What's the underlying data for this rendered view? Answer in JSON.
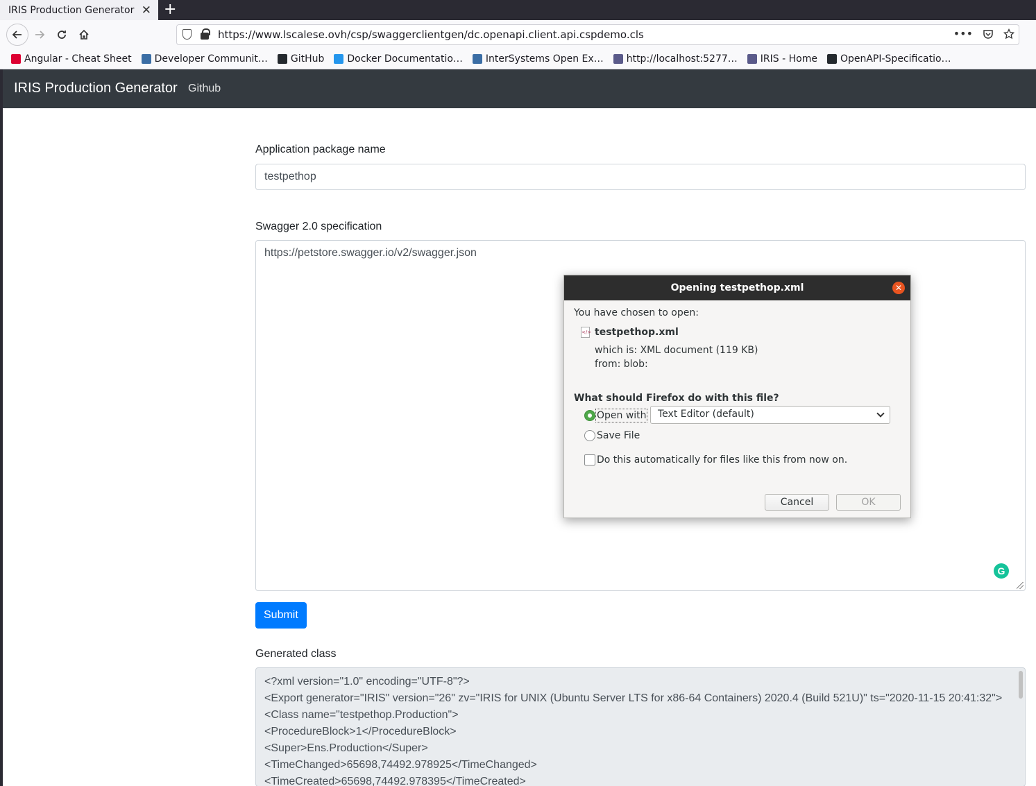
{
  "browser": {
    "tab_title": "IRIS Production Generator",
    "tab_close": "✕",
    "new_tab": "+",
    "url": "https://www.lscalese.ovh/csp/swaggerclientgen/dc.openapi.client.api.cspdemo.cls",
    "bookmarks": [
      {
        "label": "Angular - Cheat Sheet",
        "icon": "angular-icon",
        "color": "#dd0031"
      },
      {
        "label": "Developer Communit…",
        "icon": "intersystems-icon",
        "color": "#3b6ea5"
      },
      {
        "label": "GitHub",
        "icon": "github-icon",
        "color": "#24292e"
      },
      {
        "label": "Docker Documentatio…",
        "icon": "docker-icon",
        "color": "#2496ed"
      },
      {
        "label": "InterSystems Open Ex…",
        "icon": "intersystems-icon",
        "color": "#3b6ea5"
      },
      {
        "label": "http://localhost:5277…",
        "icon": "iris-icon",
        "color": "#5a5a8a"
      },
      {
        "label": "IRIS - Home",
        "icon": "iris-icon",
        "color": "#5a5a8a"
      },
      {
        "label": "OpenAPI-Specificatio…",
        "icon": "github-icon",
        "color": "#24292e"
      }
    ]
  },
  "app": {
    "brand": "IRIS Production Generator",
    "nav_link": "Github"
  },
  "form": {
    "package_label": "Application package name",
    "package_value": "testpethop",
    "spec_label": "Swagger 2.0 specification",
    "spec_value": "https://petstore.swagger.io/v2/swagger.json",
    "submit_label": "Submit",
    "generated_label": "Generated class",
    "generated_lines": [
      "<?xml version=\"1.0\" encoding=\"UTF-8\"?>",
      "<Export generator=\"IRIS\" version=\"26\" zv=\"IRIS for UNIX (Ubuntu Server LTS for x86-64 Containers) 2020.4 (Build 521U)\" ts=\"2020-11-15 20:41:32\">",
      "<Class name=\"testpethop.Production\">",
      "<ProcedureBlock>1</ProcedureBlock>",
      "<Super>Ens.Production</Super>",
      "<TimeChanged>65698,74492.978925</TimeChanged>",
      "<TimeCreated>65698,74492.978395</TimeCreated>"
    ]
  },
  "dialog": {
    "title": "Opening testpethop.xml",
    "close": "✕",
    "chosen": "You have chosen to open:",
    "filename": "testpethop.xml",
    "which_is": "which is: XML document (119 KB)",
    "from": "from: blob:",
    "question": "What should Firefox do with this file?",
    "open_with": "Open with",
    "open_with_app": "Text Editor (default)",
    "save_file": "Save File",
    "auto": "Do this automatically for files like this from now on.",
    "cancel": "Cancel",
    "ok": "OK"
  },
  "colors": {
    "navbar_bg": "#343a40",
    "primary": "#007bff",
    "dialog_title_bg": "#2d2d2d",
    "close_btn": "#e95420",
    "radio_on": "#4fa84a"
  }
}
